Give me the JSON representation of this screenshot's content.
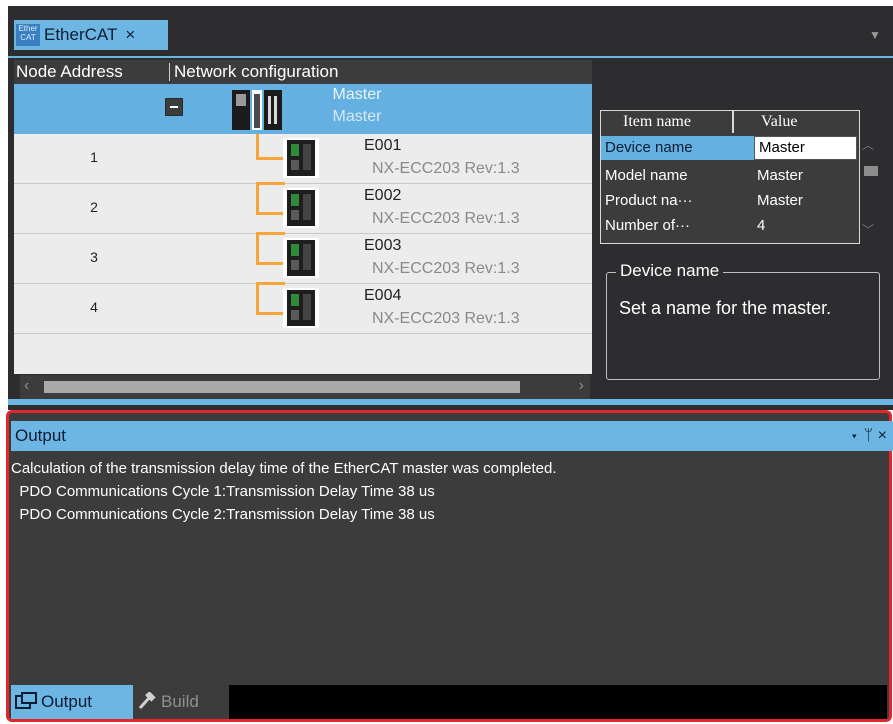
{
  "document_tab": {
    "label": "EtherCAT",
    "close": "×",
    "icon_text": "Ether CAT"
  },
  "network": {
    "col_node_address": "Node Address",
    "col_network_configuration": "Network configuration",
    "master": {
      "name": "Master",
      "model": "Master"
    },
    "nodes": [
      {
        "address": "1",
        "name": "E001",
        "model": "NX-ECC203 Rev:1.3"
      },
      {
        "address": "2",
        "name": "E002",
        "model": "NX-ECC203 Rev:1.3"
      },
      {
        "address": "3",
        "name": "E003",
        "model": "NX-ECC203 Rev:1.3"
      },
      {
        "address": "4",
        "name": "E004",
        "model": "NX-ECC203 Rev:1.3"
      }
    ]
  },
  "properties": {
    "header_item": "Item name",
    "header_value": "Value",
    "rows": [
      {
        "key": "Device name",
        "value": "Master"
      },
      {
        "key": "Model name",
        "value": "Master"
      },
      {
        "key": "Product na···",
        "value": "Master"
      },
      {
        "key": "Number of···",
        "value": "4"
      }
    ],
    "description_title": "Device name",
    "description_text": "Set a name for the master."
  },
  "output": {
    "title": "Output",
    "buttons": {
      "dropdown": "▾",
      "pin": "ᛘ",
      "close": "×"
    },
    "lines": [
      "Calculation of the transmission delay time of the EtherCAT master was completed.",
      "  PDO Communications Cycle 1:Transmission Delay Time 38 us",
      "  PDO Communications Cycle 2:Transmission Delay Time 38 us"
    ],
    "tabs": [
      {
        "label": "Output",
        "icon": "output-icon"
      },
      {
        "label": "Build",
        "icon": "hammer-icon"
      }
    ]
  },
  "colors": {
    "accent": "#6db6e3",
    "selection": "#64b0e0",
    "highlight_border": "#e2262c",
    "connector": "#f7a43a",
    "panel_dark": "#3c3c3c"
  }
}
